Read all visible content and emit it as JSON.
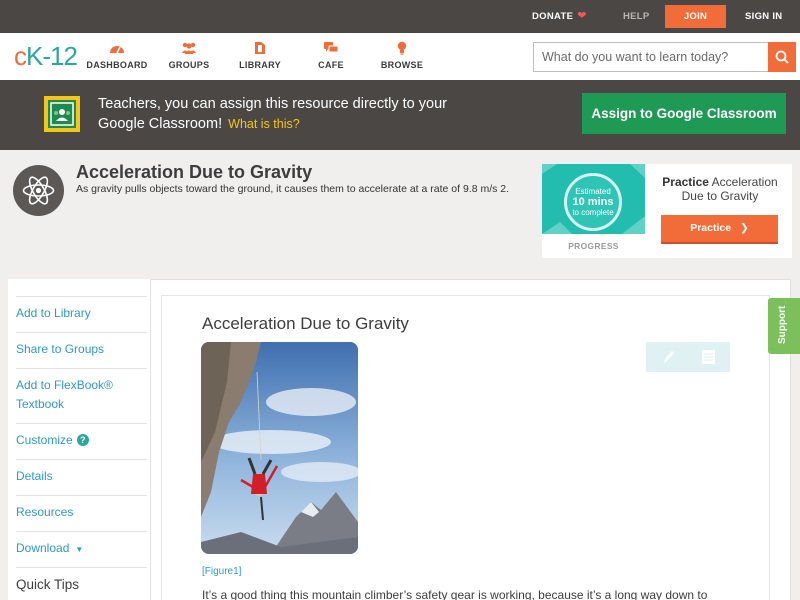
{
  "topbar": {
    "donate": "DONATE",
    "help": "HELP",
    "join": "JOIN",
    "sign_in": "SIGN IN"
  },
  "nav": {
    "logo_c": "c",
    "logo_k": "K-12",
    "items": [
      {
        "label": "DASHBOARD",
        "icon": "dashboard-icon"
      },
      {
        "label": "GROUPS",
        "icon": "groups-icon"
      },
      {
        "label": "LIBRARY",
        "icon": "library-icon"
      },
      {
        "label": "CAFE",
        "icon": "cafe-icon"
      },
      {
        "label": "BROWSE",
        "icon": "browse-icon"
      }
    ],
    "search_placeholder": "What do you want to learn today?"
  },
  "banner": {
    "text": "Teachers, you can assign this resource directly to your Google Classroom!",
    "what_link": "What is this?",
    "assign_button": "Assign to Google Classroom"
  },
  "concept": {
    "title": "Acceleration Due to Gravity",
    "description": "As gravity pulls objects toward the ground, it causes them to accelerate at a rate of 9.8 m/s 2."
  },
  "practice": {
    "estimated": "Estimated",
    "mins": "10 mins",
    "to_complete": "to complete",
    "progress_label": "PROGRESS",
    "title_bold": "Practice",
    "title_rest": "Acceleration Due to Gravity",
    "button": "Practice"
  },
  "sidebar": {
    "add_library": "Add to Library",
    "share_groups": "Share to Groups",
    "add_flexbook": "Add to FlexBook® Textbook",
    "customize": "Customize",
    "details": "Details",
    "resources": "Resources",
    "download": "Download",
    "quick_tips": "Quick Tips"
  },
  "article": {
    "title": "Acceleration Due to Gravity",
    "figure_label": "[Figure1]",
    "text": "It’s a good thing this mountain climber’s safety gear is working, because it’s a long way down to"
  },
  "support": "Support",
  "colors": {
    "accent_orange": "#f26c3a",
    "teal": "#2aa7a0",
    "classroom_green": "#1f9a55",
    "dark_bar": "#4a4745",
    "link_blue": "#2e9ac2"
  }
}
